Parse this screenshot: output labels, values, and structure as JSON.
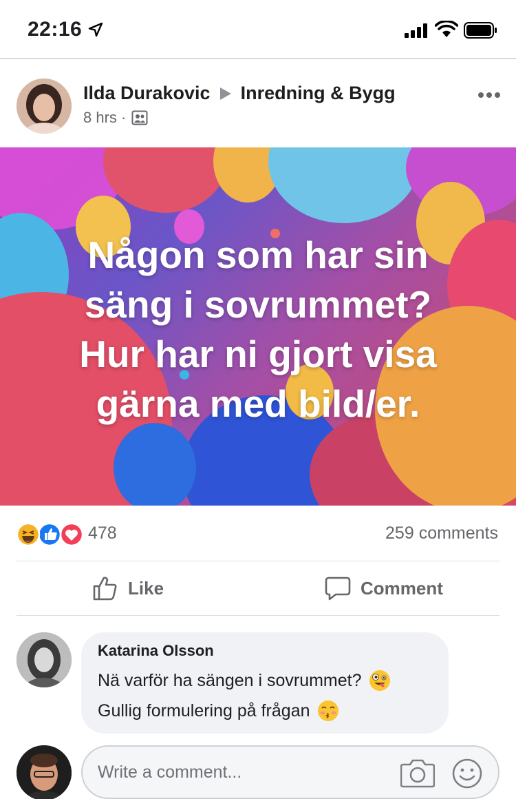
{
  "status_bar": {
    "time": "22:16",
    "icons": [
      "location-arrow-icon",
      "signal-icon",
      "wifi-icon",
      "battery-icon"
    ]
  },
  "post": {
    "author": "Ilda Durakovic",
    "group": "Inredning & Bygg",
    "time": "8 hrs",
    "separator": "·",
    "privacy_icon": "group-icon",
    "image_text": [
      "Någon som har sin",
      "säng i sovrummet?",
      "Hur har ni gjort visa",
      "gärna med bild/er."
    ],
    "reactions": {
      "icons": [
        "haha",
        "like",
        "love"
      ],
      "count": "478"
    },
    "comments_count": "259 comments",
    "actions": {
      "like": "Like",
      "comment": "Comment"
    }
  },
  "comment": {
    "author": "Katarina Olsson",
    "line1": "Nä varför ha sängen i sovrummet?",
    "line2": "Gullig formulering på frågan",
    "emojis": [
      "zany-face",
      "kissing-face"
    ]
  },
  "write_comment": {
    "placeholder": "Write a comment..."
  },
  "colors": {
    "accent_like": "#1877f2",
    "love": "#f33e58",
    "haha": "#f7b125",
    "muted_text": "#65676b"
  }
}
